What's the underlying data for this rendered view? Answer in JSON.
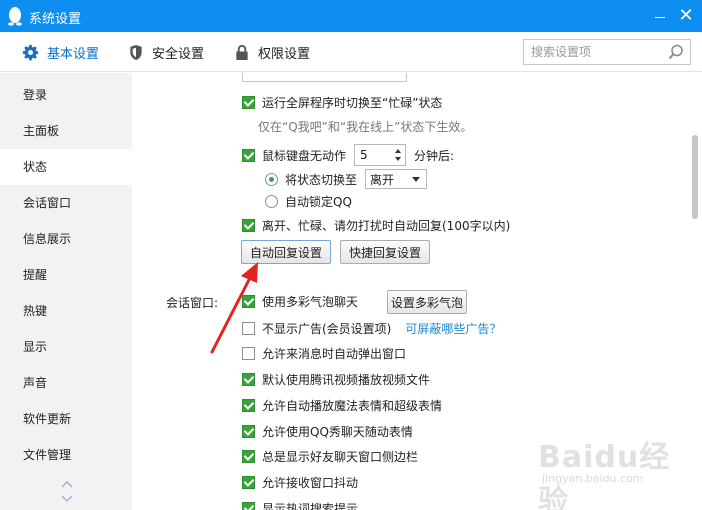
{
  "window": {
    "title": "系统设置",
    "accent": "#0e8ef0"
  },
  "topnav": {
    "tabs": [
      {
        "label": "基本设置",
        "icon": "gear-icon",
        "active": true
      },
      {
        "label": "安全设置",
        "icon": "shield-icon",
        "active": false
      },
      {
        "label": "权限设置",
        "icon": "lock-icon",
        "active": false
      }
    ],
    "search": {
      "placeholder": "搜索设置项",
      "value": ""
    }
  },
  "sidebar": {
    "items": [
      {
        "label": "登录"
      },
      {
        "label": "主面板"
      },
      {
        "label": "状态",
        "active": true
      },
      {
        "label": "会话窗口"
      },
      {
        "label": "信息展示"
      },
      {
        "label": "提醒"
      },
      {
        "label": "热键"
      },
      {
        "label": "显示"
      },
      {
        "label": "声音"
      },
      {
        "label": "软件更新"
      },
      {
        "label": "文件管理"
      }
    ]
  },
  "status": {
    "fullscreen_busy": {
      "label": "运行全屏程序时切换至“忙碌”状态",
      "checked": true
    },
    "fullscreen_note": "仅在“Q我吧”和“我在线上”状态下生效。",
    "idle": {
      "label_before": "鼠标键盘无动作",
      "minutes": "5",
      "label_after": "分钟后:",
      "checked": true
    },
    "switch_to": {
      "label": "将状态切换至",
      "selected": true,
      "option": "离开"
    },
    "auto_lock": {
      "label": "自动锁定QQ",
      "selected": false
    },
    "auto_reply": {
      "label": "离开、忙碌、请勿打扰时自动回复(100字以内)",
      "checked": true
    },
    "auto_reply_button": "自动回复设置",
    "quick_reply_button": "快捷回复设置"
  },
  "chat_window": {
    "section_label": "会话窗口:",
    "bubble": {
      "label": "使用多彩气泡聊天",
      "checked": true
    },
    "bubble_button": "设置多彩气泡",
    "no_ads": {
      "label": "不显示广告(会员设置项)",
      "checked": false
    },
    "ads_link": "可屏蔽哪些广告？",
    "popup": {
      "label": "允许来消息时自动弹出窗口",
      "checked": false
    },
    "tencent_video": {
      "label": "默认使用腾讯视频播放视频文件",
      "checked": true
    },
    "magic_emoji": {
      "label": "允许自动播放魔法表情和超级表情",
      "checked": true
    },
    "qq_show": {
      "label": "允许使用QQ秀聊天随动表情",
      "checked": true
    },
    "sidebar_always": {
      "label": "总是显示好友聊天窗口侧边栏",
      "checked": true
    },
    "shake": {
      "label": "允许接收窗口抖动",
      "checked": true
    },
    "hotword": {
      "label": "显示热词搜索提示",
      "checked": true
    }
  },
  "watermark": {
    "text": "Baidu经验",
    "url": "jingyan.baidu.com"
  }
}
